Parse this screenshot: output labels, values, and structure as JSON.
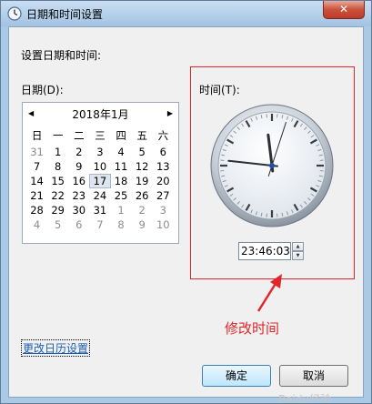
{
  "window": {
    "title": "日期和时间设置",
    "close_label": "✕"
  },
  "prompt": "设置日期和时间:",
  "date_section": {
    "label": "日期(D):",
    "calendar": {
      "prev": "◀",
      "next": "▶",
      "month": "2018年1月",
      "weekdays": [
        "日",
        "一",
        "二",
        "三",
        "四",
        "五",
        "六"
      ],
      "weeks": [
        [
          {
            "d": "31",
            "m": true
          },
          {
            "d": "1"
          },
          {
            "d": "2"
          },
          {
            "d": "3"
          },
          {
            "d": "4"
          },
          {
            "d": "5"
          },
          {
            "d": "6"
          }
        ],
        [
          {
            "d": "7"
          },
          {
            "d": "8"
          },
          {
            "d": "9"
          },
          {
            "d": "10"
          },
          {
            "d": "11"
          },
          {
            "d": "12"
          },
          {
            "d": "13"
          }
        ],
        [
          {
            "d": "14"
          },
          {
            "d": "15"
          },
          {
            "d": "16"
          },
          {
            "d": "17",
            "t": true
          },
          {
            "d": "18"
          },
          {
            "d": "19"
          },
          {
            "d": "20"
          }
        ],
        [
          {
            "d": "21"
          },
          {
            "d": "22"
          },
          {
            "d": "23"
          },
          {
            "d": "24"
          },
          {
            "d": "25"
          },
          {
            "d": "26"
          },
          {
            "d": "27"
          }
        ],
        [
          {
            "d": "28"
          },
          {
            "d": "29"
          },
          {
            "d": "30"
          },
          {
            "d": "31"
          },
          {
            "d": "1",
            "m": true
          },
          {
            "d": "2",
            "m": true
          },
          {
            "d": "3",
            "m": true
          }
        ],
        [
          {
            "d": "4",
            "m": true
          },
          {
            "d": "5",
            "m": true
          },
          {
            "d": "6",
            "m": true
          },
          {
            "d": "7",
            "m": true
          },
          {
            "d": "8",
            "m": true
          },
          {
            "d": "9",
            "m": true
          },
          {
            "d": "10",
            "m": true
          }
        ]
      ]
    }
  },
  "time_section": {
    "label": "时间(T):",
    "value": "23:46:03",
    "hour": 23,
    "minute": 46,
    "second": 3,
    "spin_up": "▲",
    "spin_down": "▼"
  },
  "annotation": {
    "text": "修改时间",
    "color": "#e0262a"
  },
  "link": {
    "label": "更改日历设置"
  },
  "buttons": {
    "ok": "确定",
    "cancel": "取消"
  },
  "watermark": "Baidu经验"
}
